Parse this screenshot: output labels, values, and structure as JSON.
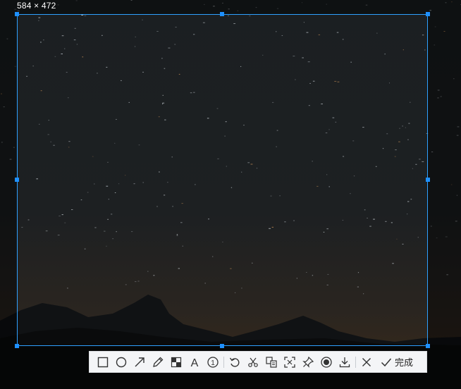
{
  "selection": {
    "size_label": "584 × 472",
    "accent_color": "#1e90ff"
  },
  "toolbar": {
    "tools": [
      {
        "name": "rectangle-tool",
        "icon": "rectangle-icon"
      },
      {
        "name": "ellipse-tool",
        "icon": "ellipse-icon"
      },
      {
        "name": "arrow-tool",
        "icon": "arrow-icon"
      },
      {
        "name": "pencil-tool",
        "icon": "pencil-icon"
      },
      {
        "name": "mosaic-tool",
        "icon": "mosaic-icon"
      },
      {
        "name": "text-tool",
        "icon": "text-icon"
      },
      {
        "name": "number-marker-tool",
        "icon": "number-marker-icon"
      },
      {
        "name": "undo-button",
        "icon": "undo-icon"
      },
      {
        "name": "scissors-button",
        "icon": "scissors-icon"
      },
      {
        "name": "ocr-button",
        "icon": "ocr-icon"
      },
      {
        "name": "screenshot-expand-button",
        "icon": "expand-icon"
      },
      {
        "name": "pin-button",
        "icon": "pin-icon"
      },
      {
        "name": "record-button",
        "icon": "record-icon"
      },
      {
        "name": "save-button",
        "icon": "download-icon"
      },
      {
        "name": "cancel-button",
        "icon": "close-icon"
      }
    ],
    "text_tool_glyph": "A",
    "number_marker_glyph": "1",
    "done_label": "完成"
  }
}
